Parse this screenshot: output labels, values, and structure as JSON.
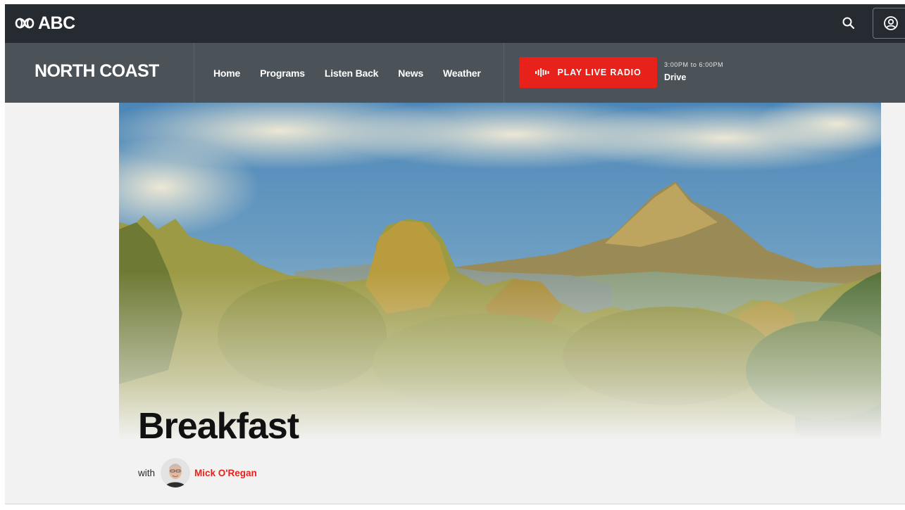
{
  "header": {
    "logo_text": "ABC",
    "search_icon": "search-icon",
    "account_icon": "user-circle-icon"
  },
  "station": {
    "name": "NORTH COAST",
    "nav": [
      {
        "label": "Home"
      },
      {
        "label": "Programs"
      },
      {
        "label": "Listen Back"
      },
      {
        "label": "News"
      },
      {
        "label": "Weather"
      }
    ],
    "live_button_label": "PLAY LIVE RADIO",
    "live_icon": "audio-wave-icon",
    "on_air_time": "3:00PM to 6:00PM",
    "on_air_show": "Drive"
  },
  "program": {
    "title": "Breakfast",
    "with_label": "with",
    "host_name": "Mick O'Regan"
  },
  "colors": {
    "topbar": "#262a31",
    "stationbar": "#4b5359",
    "accent_red": "#e8211a",
    "page_bg": "#f2f2f2"
  }
}
